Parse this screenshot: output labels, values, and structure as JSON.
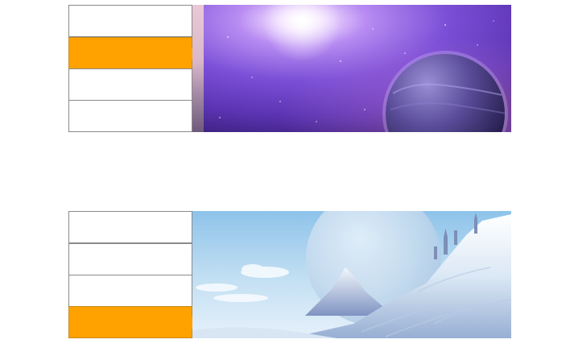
{
  "widgets": [
    {
      "menu": {
        "items": [
          {
            "label": "",
            "active": false
          },
          {
            "label": "",
            "active": true
          },
          {
            "label": "",
            "active": false
          },
          {
            "label": "",
            "active": false
          }
        ]
      },
      "panel": {
        "image": "purple-space-planet-image"
      }
    },
    {
      "menu": {
        "items": [
          {
            "label": "",
            "active": false
          },
          {
            "label": "",
            "active": false
          },
          {
            "label": "",
            "active": false
          },
          {
            "label": "",
            "active": true
          }
        ]
      },
      "panel": {
        "image": "snowy-mountain-castle-moon-image"
      }
    }
  ],
  "colors": {
    "active_tab": "#ffa200",
    "tab_border": "#8a8a8a"
  }
}
